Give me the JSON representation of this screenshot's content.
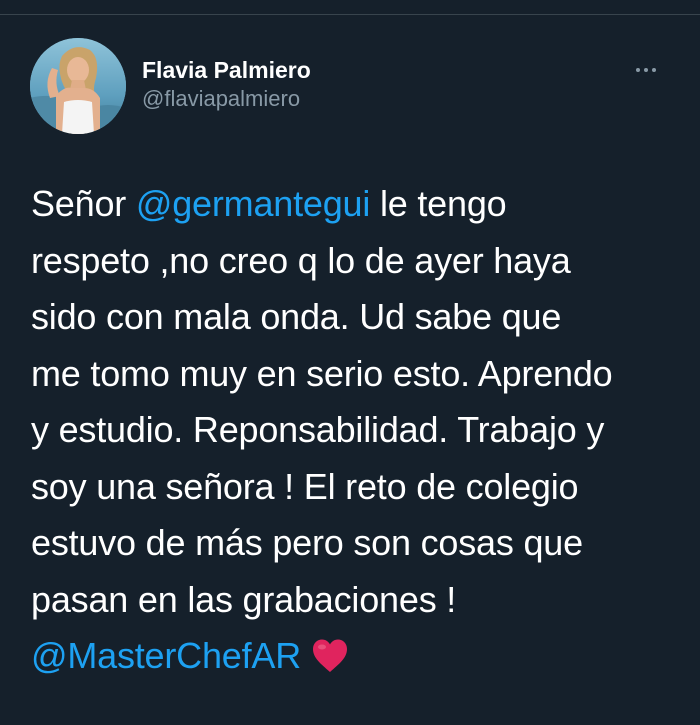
{
  "tweet": {
    "author": {
      "display_name": "Flavia Palmiero",
      "handle": "@flaviapalmiero",
      "avatar_icon": "profile-photo"
    },
    "more_icon": "more-horizontal-icon",
    "body_lines": [
      {
        "parts": [
          {
            "text": "Señor ",
            "type": "text"
          },
          {
            "text": "@germantegui",
            "type": "mention"
          },
          {
            "text": " le tengo",
            "type": "text"
          }
        ]
      },
      {
        "parts": [
          {
            "text": "respeto ,no creo q lo de ayer haya",
            "type": "text"
          }
        ]
      },
      {
        "parts": [
          {
            "text": "sido con mala onda. Ud sabe que",
            "type": "text"
          }
        ]
      },
      {
        "parts": [
          {
            "text": "me tomo muy en serio esto. Aprendo",
            "type": "text"
          }
        ]
      },
      {
        "parts": [
          {
            "text": "y estudio. Reponsabilidad. Trabajo y",
            "type": "text"
          }
        ]
      },
      {
        "parts": [
          {
            "text": "soy una señora ! El reto de colegio",
            "type": "text"
          }
        ]
      },
      {
        "parts": [
          {
            "text": "estuvo de más pero son cosas que",
            "type": "text"
          }
        ]
      },
      {
        "parts": [
          {
            "text": "pasan en las grabaciones !",
            "type": "text"
          }
        ]
      },
      {
        "parts": [
          {
            "text": "@MasterChefAR",
            "type": "mention"
          },
          {
            "text": "",
            "type": "heart"
          }
        ]
      }
    ],
    "emoji": "red-heart-icon"
  },
  "colors": {
    "background": "#15202b",
    "text": "#ffffff",
    "secondary_text": "#8899a6",
    "mention": "#1da1f2",
    "heart": "#e0245e"
  }
}
